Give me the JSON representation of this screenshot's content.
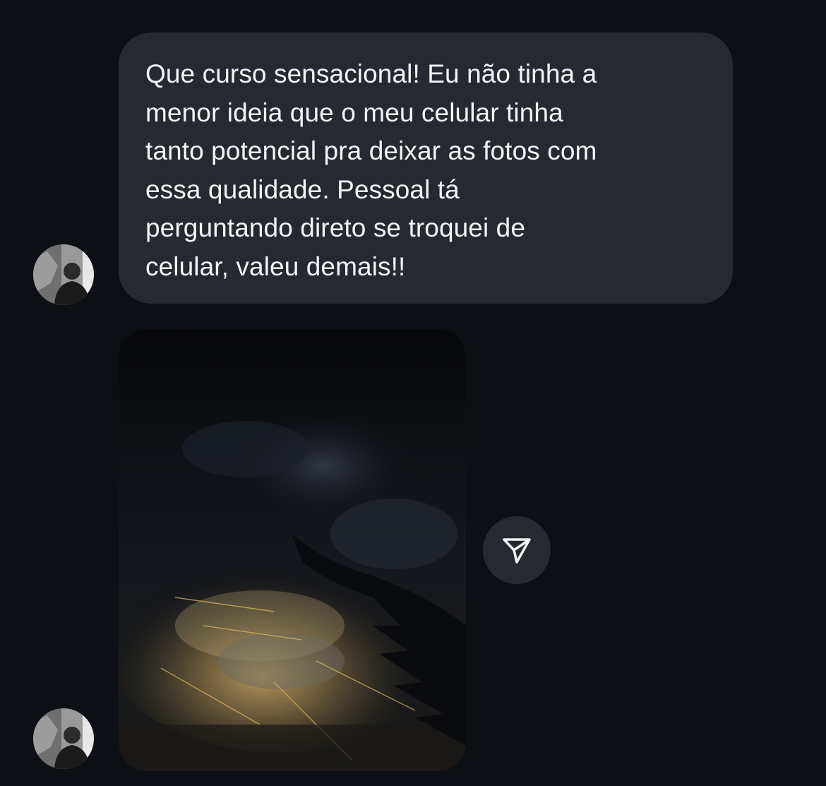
{
  "conversation": {
    "message_text": "Que curso sensacional! Eu não tinha a menor ideia que o meu celular tinha tanto potencial pra deixar as fotos com essa qualidade. Pessoal tá perguntando direto se troquei de celular, valeu demais!!",
    "message_lines": [
      "Que curso sensacional! Eu não tinha a",
      "menor ideia que o meu celular tinha",
      "tanto potencial pra deixar as fotos com",
      "essa qualidade. Pessoal tá",
      "perguntando direto se troquei de",
      "celular, valeu demais!!"
    ],
    "photo_description_icon": "photo-airplane-wing-night-city",
    "share_icon": "paper-plane-icon"
  },
  "colors": {
    "background": "#0c0f14",
    "bubble": "#262a30",
    "text": "#f3f4f6"
  }
}
